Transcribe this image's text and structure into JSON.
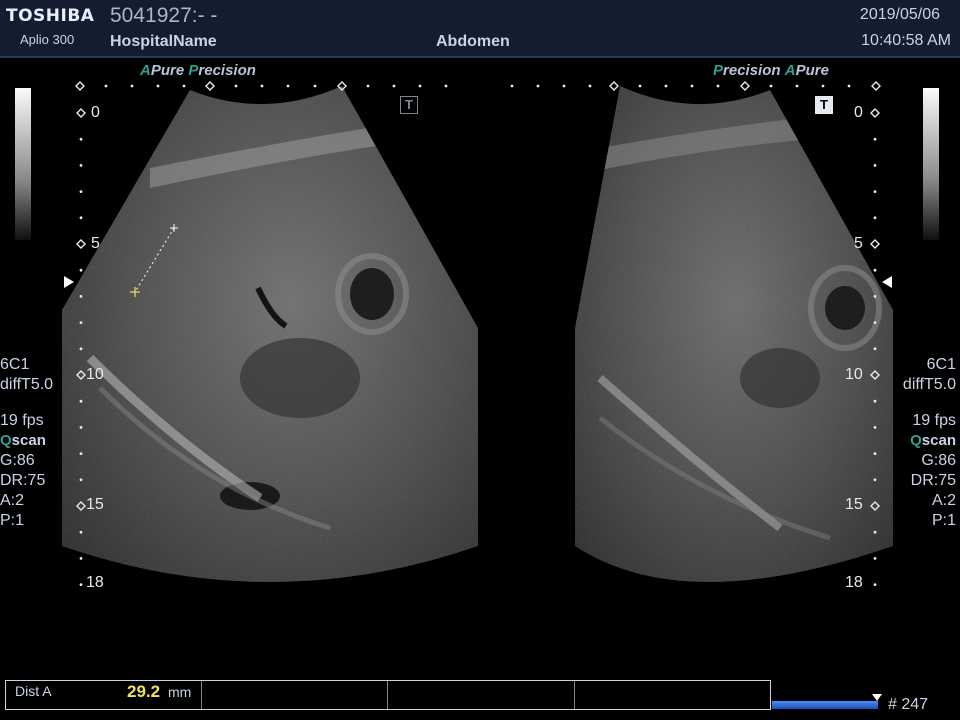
{
  "header": {
    "brand": "TOSHIBA",
    "model": "Aplio 300",
    "patient_id": "5041927:- -",
    "hospital": "HospitalName",
    "exam": "Abdomen",
    "date": "2019/05/06",
    "time": "10:40:58 AM"
  },
  "left_panel": {
    "precision_a": "A",
    "precision_pure": "Pure",
    "precision_p": "P",
    "precision_recision": "recision",
    "tmark": "T",
    "depths": [
      "0",
      "5",
      "10",
      "15",
      "18"
    ],
    "params": {
      "probe": "6C1",
      "mode": "diffT5.0",
      "fps": "19 fps",
      "qscan_q": "Q",
      "qscan_rest": "scan",
      "gain": "G:86",
      "dr": "DR:75",
      "a": "A:2",
      "p": "P:1"
    }
  },
  "right_panel": {
    "precision_p": "P",
    "precision_recision": "recision",
    "precision_a": "A",
    "precision_pure": "Pure",
    "tmark": "T",
    "depths": [
      "0",
      "5",
      "10",
      "15",
      "18"
    ],
    "params": {
      "probe": "6C1",
      "mode": "diffT5.0",
      "fps": "19 fps",
      "qscan_q": "Q",
      "qscan_rest": "scan",
      "gain": "G:86",
      "dr": "DR:75",
      "a": "A:2",
      "p": "P:1"
    }
  },
  "measurement": {
    "label": "Dist A",
    "value": "29.2",
    "unit": "mm"
  },
  "frame": {
    "count": "# 247",
    "progress": 1.0
  },
  "colors": {
    "header_bg": "#141c30",
    "accent_teal": "#2f9f8f",
    "measure_yellow": "#f0e060",
    "frame_bar_blue": "#1c4fb0"
  },
  "icons": [
    "t-marker-icon",
    "orientation-marker-icon",
    "caliper-cross-icon",
    "frame-marker-icon"
  ]
}
